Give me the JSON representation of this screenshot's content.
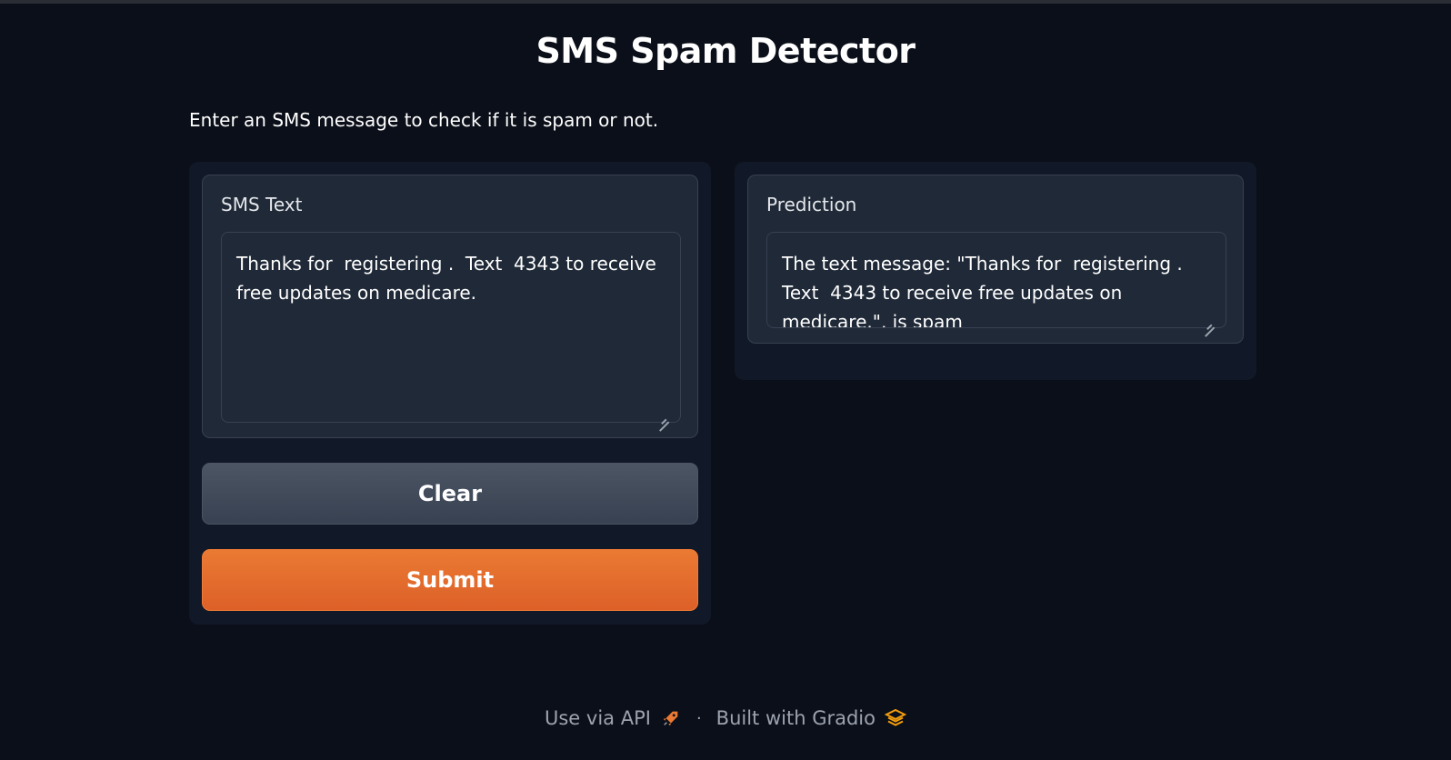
{
  "header": {
    "title": "SMS Spam Detector",
    "description": "Enter an SMS message to check if it is spam or not."
  },
  "input": {
    "label": "SMS Text",
    "value": "Thanks for  registering .  Text  4343 to receive free updates on medicare."
  },
  "output": {
    "label": "Prediction",
    "value": "The text message: \"Thanks for  registering .  Text  4343 to receive free updates on medicare.\", is spam"
  },
  "buttons": {
    "clear": "Clear",
    "submit": "Submit"
  },
  "footer": {
    "api_link": "Use via API",
    "separator": "·",
    "built_with": "Built with Gradio"
  },
  "colors": {
    "background": "#0b0f19",
    "panel": "#111827",
    "block": "#1f2937",
    "accent": "#ea7a33",
    "secondary_button": "#4b5563"
  },
  "icons": {
    "api": "rocket-icon",
    "gradio": "gradio-logo-icon"
  }
}
